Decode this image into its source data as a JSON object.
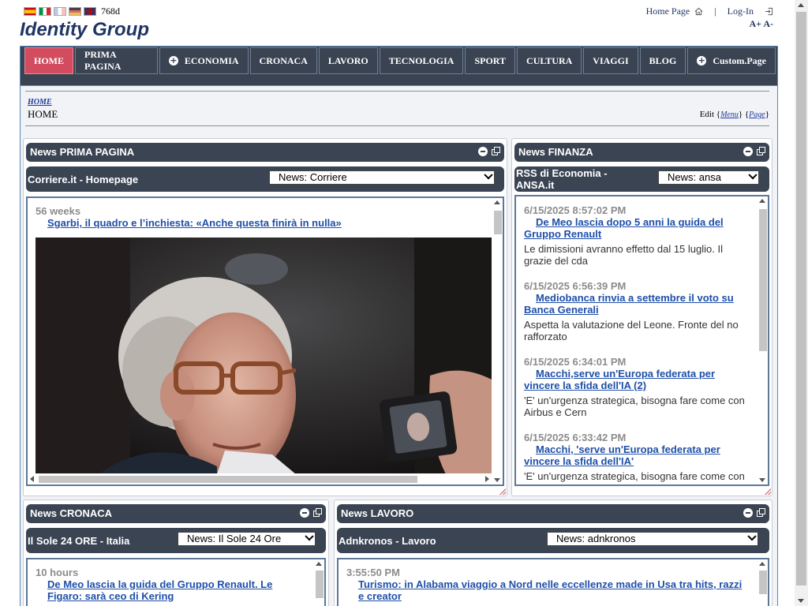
{
  "top": {
    "flags": [
      "es-flag",
      "it-flag",
      "fr-flag",
      "de-flag",
      "en-flag"
    ],
    "resolution": "768d",
    "home_link": "Home Page",
    "separator": "|",
    "login_link": "Log-In",
    "font_plus": "A+",
    "font_minus": "A-"
  },
  "brand": "Identity Group",
  "nav": [
    {
      "label": "HOME",
      "active": true,
      "plus": false
    },
    {
      "label": "PRIMA PAGINA",
      "active": false,
      "plus": false
    },
    {
      "label": "ECONOMIA",
      "active": false,
      "plus": true
    },
    {
      "label": "CRONACA",
      "active": false,
      "plus": false
    },
    {
      "label": "LAVORO",
      "active": false,
      "plus": false
    },
    {
      "label": "TECNOLOGIA",
      "active": false,
      "plus": false
    },
    {
      "label": "SPORT",
      "active": false,
      "plus": false
    },
    {
      "label": "CULTURA",
      "active": false,
      "plus": false
    },
    {
      "label": "VIAGGI",
      "active": false,
      "plus": false
    },
    {
      "label": "BLOG",
      "active": false,
      "plus": false
    },
    {
      "label": "Custom.Page",
      "active": false,
      "plus": true
    }
  ],
  "crumb": {
    "link": "HOME",
    "title": "HOME",
    "edit_prefix": "Edit {",
    "edit_menu": "Menu",
    "edit_mid": "} {",
    "edit_page": "Page",
    "edit_suffix": "}"
  },
  "portlets": {
    "prima": {
      "title": "News PRIMA PAGINA",
      "source": "Corriere.it - Homepage",
      "select": "News: Corriere",
      "item": {
        "ago": "56 weeks",
        "headline": "Sgarbi, il quadro e l’inchiesta: «Anche questa finirà in nulla»"
      }
    },
    "finanza": {
      "title": "News FINANZA",
      "source": "RSS di Economia - ANSA.it",
      "select": "News: ansa",
      "items": [
        {
          "ago": "6/15/2025 8:57:02 PM",
          "headline": "De Meo lascia dopo 5 anni la guida del Gruppo Renault",
          "summary": "Le dimissioni avranno effetto dal 15 luglio. Il grazie del cda"
        },
        {
          "ago": "6/15/2025 6:56:39 PM",
          "headline": "Mediobanca rinvia a settembre il voto su Banca Generali",
          "summary": "Aspetta la valutazione del Leone. Fronte del no rafforzato"
        },
        {
          "ago": "6/15/2025 6:34:01 PM",
          "headline": "Macchi,serve un'Europa federata per vincere la sfida dell'IA (2)",
          "summary": "'E' un'urgenza strategica, bisogna fare come con Airbus e Cern"
        },
        {
          "ago": "6/15/2025 6:33:42 PM",
          "headline": "Macchi, 'serve un'Europa federata per vincere la sfida dell'IA'",
          "summary": "'E' un'urgenza strategica, bisogna fare come con"
        }
      ]
    },
    "cronaca": {
      "title": "News CRONACA",
      "source": "Il Sole 24 ORE - Italia",
      "select": "News: Il Sole 24 Ore",
      "item": {
        "ago": "10 hours",
        "headline": "De Meo lascia la guida del Gruppo Renault. Le Figaro: sarà ceo di Kering"
      }
    },
    "lavoro": {
      "title": "News LAVORO",
      "source": "Adnkronos - Lavoro",
      "select": "News: adnkronos",
      "item": {
        "ago": "3:55:50 PM",
        "headline": "Turismo: in Alabama viaggio a Nord nelle eccellenze made in Usa tra hits, razzi e creator"
      }
    }
  }
}
